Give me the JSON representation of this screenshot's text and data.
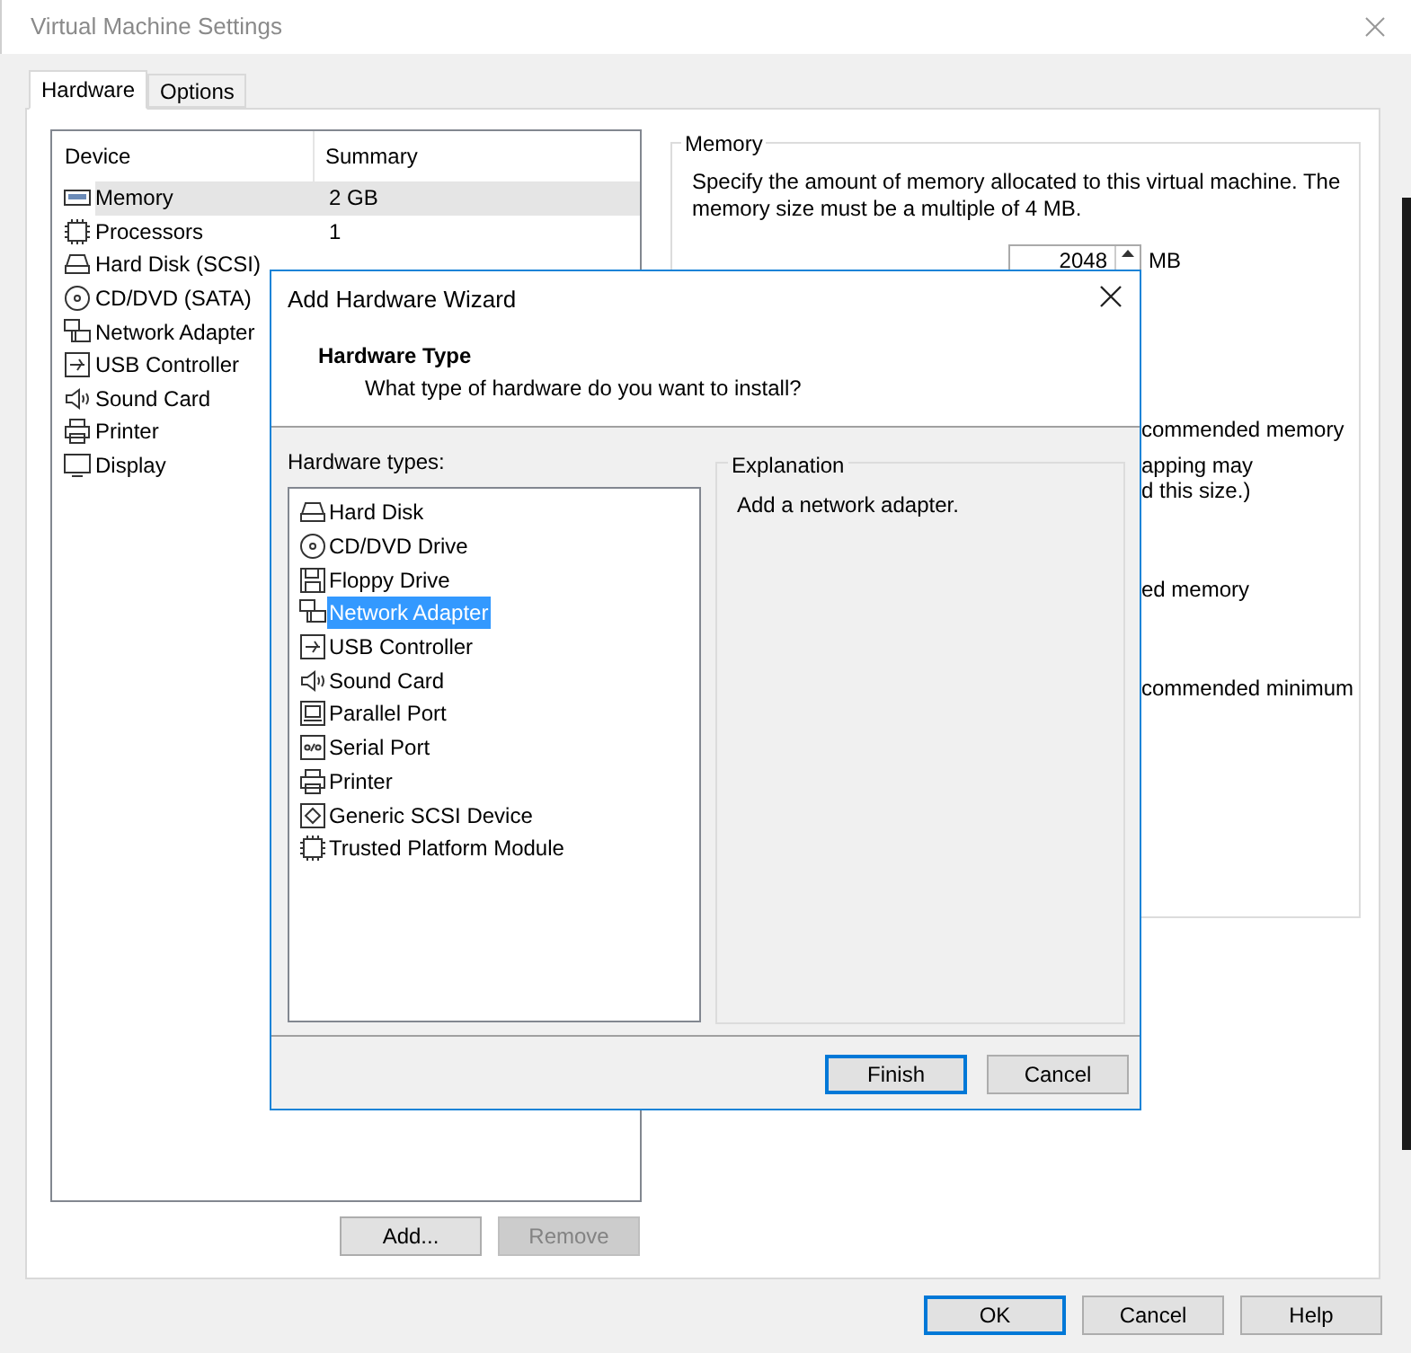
{
  "window": {
    "title": "Virtual Machine Settings"
  },
  "tabs": [
    {
      "label": "Hardware",
      "selected": true
    },
    {
      "label": "Options",
      "selected": false
    }
  ],
  "device_table": {
    "columns": [
      "Device",
      "Summary"
    ],
    "rows": [
      {
        "kind": "memory",
        "device": "Memory",
        "summary": "2 GB",
        "selected": true
      },
      {
        "kind": "cpu",
        "device": "Processors",
        "summary": "1",
        "selected": false
      },
      {
        "kind": "disk",
        "device": "Hard Disk (SCSI)",
        "selected": false
      },
      {
        "kind": "cd",
        "device": "CD/DVD (SATA)",
        "selected": false
      },
      {
        "kind": "network",
        "device": "Network Adapter",
        "selected": false
      },
      {
        "kind": "usb",
        "device": "USB Controller",
        "selected": false
      },
      {
        "kind": "sound",
        "device": "Sound Card",
        "selected": false
      },
      {
        "kind": "printer",
        "device": "Printer",
        "selected": false
      },
      {
        "kind": "display",
        "device": "Display",
        "selected": false
      }
    ]
  },
  "device_buttons": [
    {
      "label": "Add...",
      "disabled": false
    },
    {
      "label": "Remove",
      "disabled": true
    }
  ],
  "memory_group": {
    "title": "Memory",
    "description": "Specify the amount of memory allocated to this virtual machine. The memory size must be a multiple of 4 MB.",
    "value": "2048",
    "unit": "MB",
    "visible_fragments": [
      {
        "lines": [
          "commended memory"
        ]
      },
      {
        "lines": [
          "apping may",
          "d this size.)"
        ]
      },
      {
        "lines": [
          "ed memory"
        ]
      },
      {
        "lines": [
          "commended minimum"
        ]
      }
    ]
  },
  "buttons": [
    {
      "label": "OK",
      "default": true
    },
    {
      "label": "Cancel",
      "default": false
    },
    {
      "label": "Help",
      "default": false
    }
  ],
  "wizard": {
    "title": "Add Hardware Wizard",
    "heading": "Hardware Type",
    "subheading": "What type of hardware do you want to install?",
    "list_label": "Hardware types:",
    "hardware_types": [
      {
        "kind": "disk",
        "label": "Hard Disk",
        "selected": false
      },
      {
        "kind": "cd",
        "label": "CD/DVD Drive",
        "selected": false
      },
      {
        "kind": "floppy",
        "label": "Floppy Drive",
        "selected": false
      },
      {
        "kind": "network",
        "label": "Network Adapter",
        "selected": true
      },
      {
        "kind": "usb",
        "label": "USB Controller",
        "selected": false
      },
      {
        "kind": "sound",
        "label": "Sound Card",
        "selected": false
      },
      {
        "kind": "parallel",
        "label": "Parallel Port",
        "selected": false
      },
      {
        "kind": "serial",
        "label": "Serial Port",
        "selected": false
      },
      {
        "kind": "printer",
        "label": "Printer",
        "selected": false
      },
      {
        "kind": "scsi",
        "label": "Generic SCSI Device",
        "selected": false
      },
      {
        "kind": "tpm",
        "label": "Trusted Platform Module",
        "selected": false
      }
    ],
    "explanation_title": "Explanation",
    "explanation": "Add a network adapter.",
    "buttons": [
      {
        "label": "Finish",
        "default": true
      },
      {
        "label": "Cancel",
        "default": false
      }
    ]
  }
}
